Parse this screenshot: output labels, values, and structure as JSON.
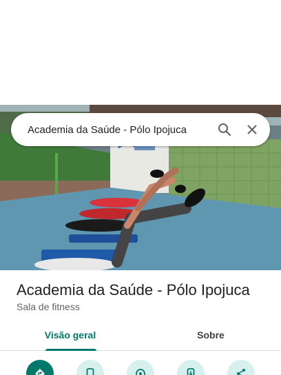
{
  "search": {
    "query": "Academia da Saúde - Pólo Ipojuca"
  },
  "place": {
    "name": "Academia da Saúde - Pólo Ipojuca",
    "category": "Sala de fitness"
  },
  "tabs": [
    {
      "label": "Visão geral",
      "active": true
    },
    {
      "label": "Sobre",
      "active": false
    }
  ],
  "actions": [
    {
      "icon": "directions-icon"
    },
    {
      "icon": "phone-icon"
    },
    {
      "icon": "save-icon"
    },
    {
      "icon": "send-to-phone-icon"
    },
    {
      "icon": "share-icon"
    }
  ],
  "colors": {
    "accent": "#00796b",
    "accent_light": "#d6f0ed",
    "text": "#202124",
    "secondary_text": "#5f6368"
  }
}
